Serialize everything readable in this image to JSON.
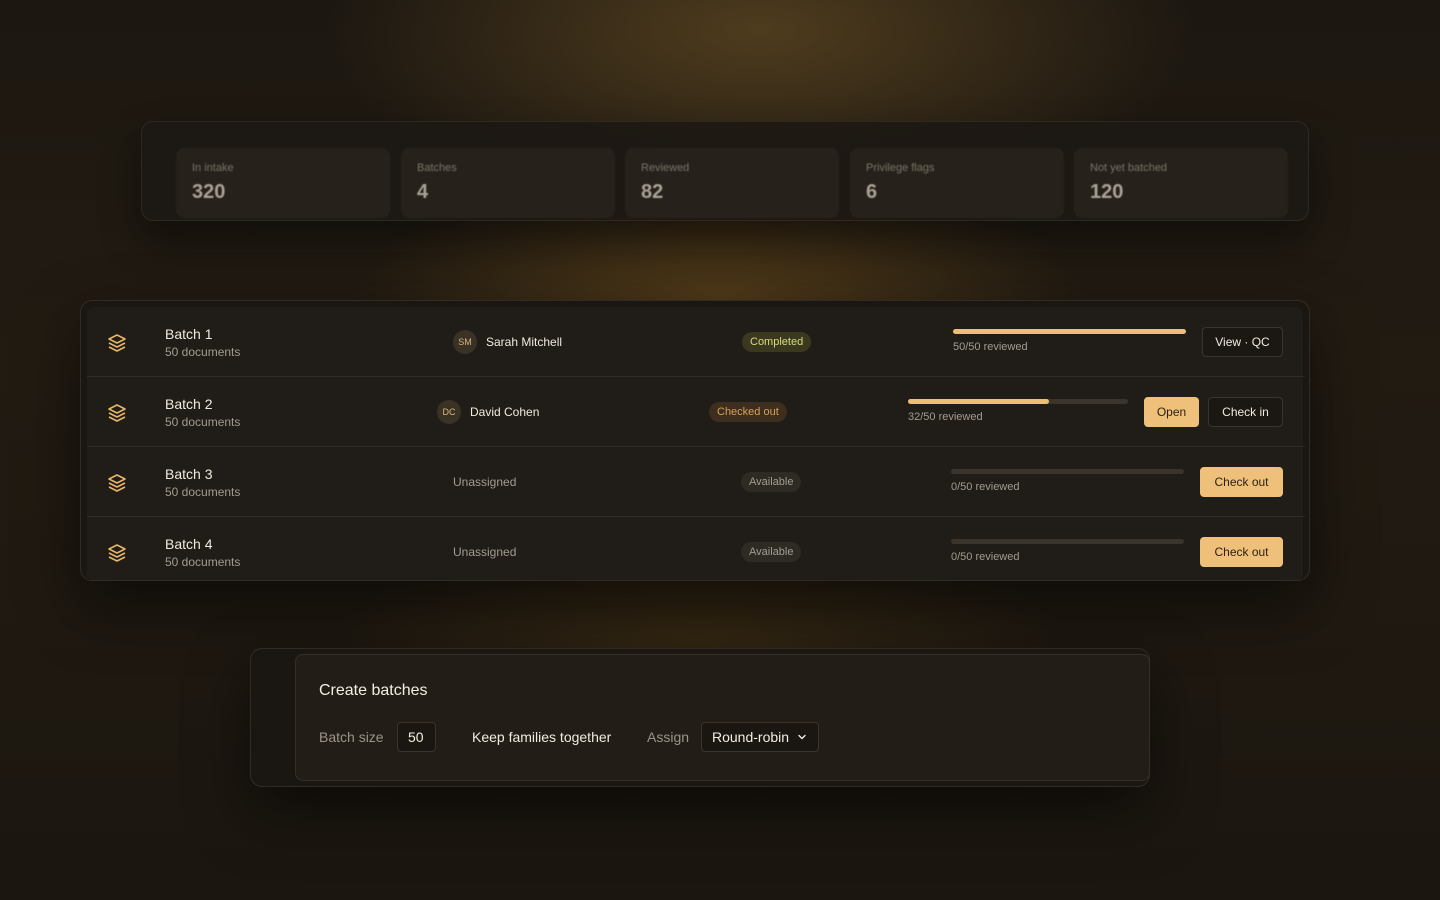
{
  "stats": [
    {
      "label": "In intake",
      "value": "320"
    },
    {
      "label": "Batches",
      "value": "4"
    },
    {
      "label": "Reviewed",
      "value": "82"
    },
    {
      "label": "Privilege flags",
      "value": "6"
    },
    {
      "label": "Not yet batched",
      "value": "120"
    }
  ],
  "batches": [
    {
      "name": "Batch 1",
      "docs": "50 documents",
      "assignee_initials": "SM",
      "assignee": "Sarah Mitchell",
      "status": "Completed",
      "progress": 1.0,
      "progress_text": "50/50 reviewed",
      "actions": [
        "View · QC"
      ]
    },
    {
      "name": "Batch 2",
      "docs": "50 documents",
      "assignee_initials": "DC",
      "assignee": "David Cohen",
      "status": "Checked out",
      "progress": 0.64,
      "progress_text": "32/50 reviewed",
      "actions": [
        "Open",
        "Check in"
      ]
    },
    {
      "name": "Batch 3",
      "docs": "50 documents",
      "assignee": "Unassigned",
      "status": "Available",
      "progress": 0.0,
      "progress_text": "0/50 reviewed",
      "actions": [
        "Check out"
      ]
    },
    {
      "name": "Batch 4",
      "docs": "50 documents",
      "assignee": "Unassigned",
      "status": "Available",
      "progress": 0.0,
      "progress_text": "0/50 reviewed",
      "actions": [
        "Check out"
      ]
    }
  ],
  "create": {
    "title": "Create batches",
    "batch_size_label": "Batch size",
    "batch_size_value": "50",
    "keep_families_label": "Keep families together",
    "assign_label": "Assign",
    "assign_value": "Round-robin"
  },
  "icons": {
    "batch": "layers-icon",
    "dropdown": "chevron-down-icon"
  },
  "colors": {
    "accent": "#efc079",
    "completed": "#d8dc7c",
    "checked_out": "#d7a15c"
  }
}
